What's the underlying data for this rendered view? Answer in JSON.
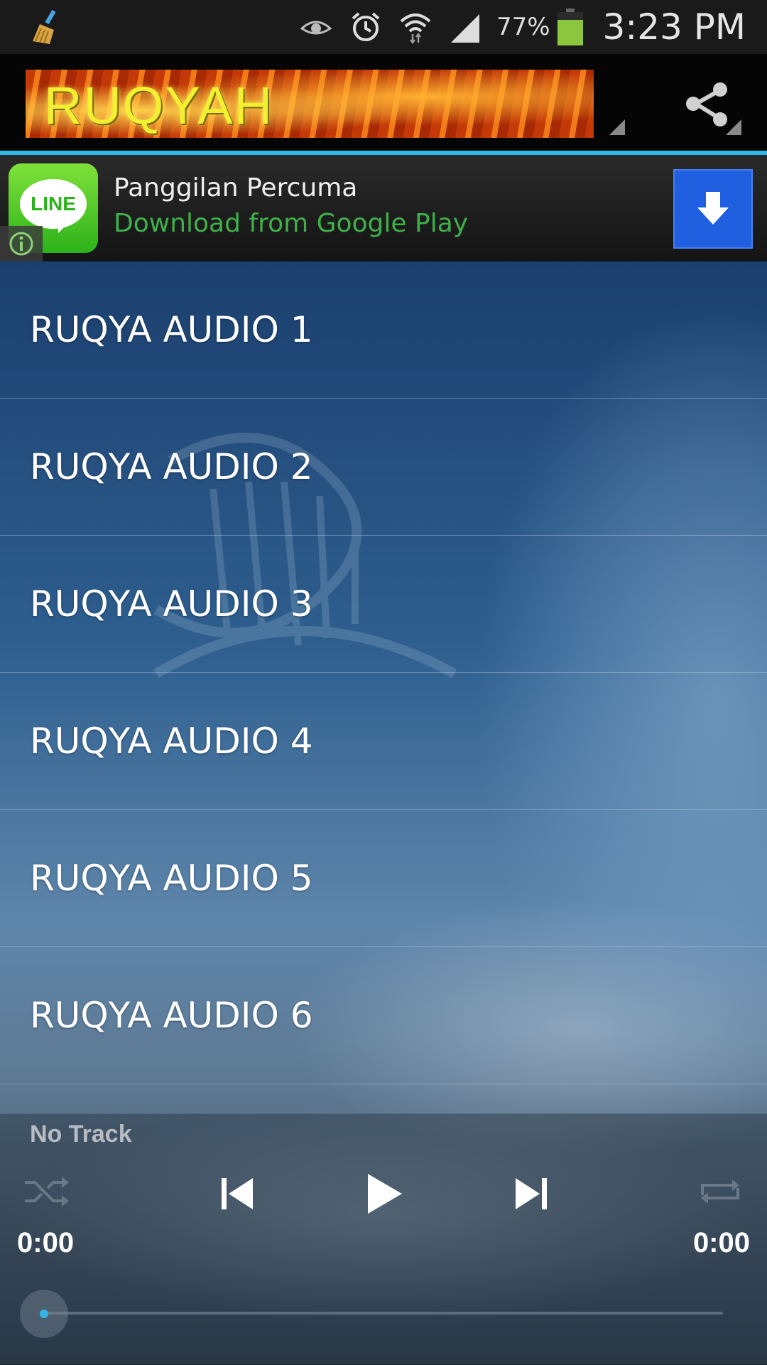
{
  "status_bar": {
    "battery_percent": "77%",
    "time": "3:23 PM",
    "icons": [
      "cleaner-broom-icon",
      "eye-icon",
      "alarm-icon",
      "wifi-icon",
      "signal-icon",
      "battery-icon"
    ]
  },
  "action_bar": {
    "banner_text": "RUQYAH",
    "share_icon": "share-icon",
    "accent_color": "#33b5e5"
  },
  "ad": {
    "logo_text": "LINE",
    "title": "Panggilan Percuma",
    "subtitle": "Download from Google Play",
    "subtitle_color": "#3fb04a",
    "download_icon": "download-arrow-icon",
    "download_button_color": "#1f5fe0"
  },
  "tracks": [
    {
      "label": "RUQYA AUDIO 1"
    },
    {
      "label": "RUQYA AUDIO 2"
    },
    {
      "label": "RUQYA AUDIO 3"
    },
    {
      "label": "RUQYA AUDIO 4"
    },
    {
      "label": "RUQYA AUDIO 5"
    },
    {
      "label": "RUQYA AUDIO 6"
    }
  ],
  "player": {
    "now_playing": "No Track",
    "elapsed": "0:00",
    "total": "0:00",
    "progress_fraction": 0,
    "icons": [
      "shuffle-icon",
      "previous-icon",
      "play-icon",
      "next-icon",
      "repeat-icon"
    ]
  }
}
